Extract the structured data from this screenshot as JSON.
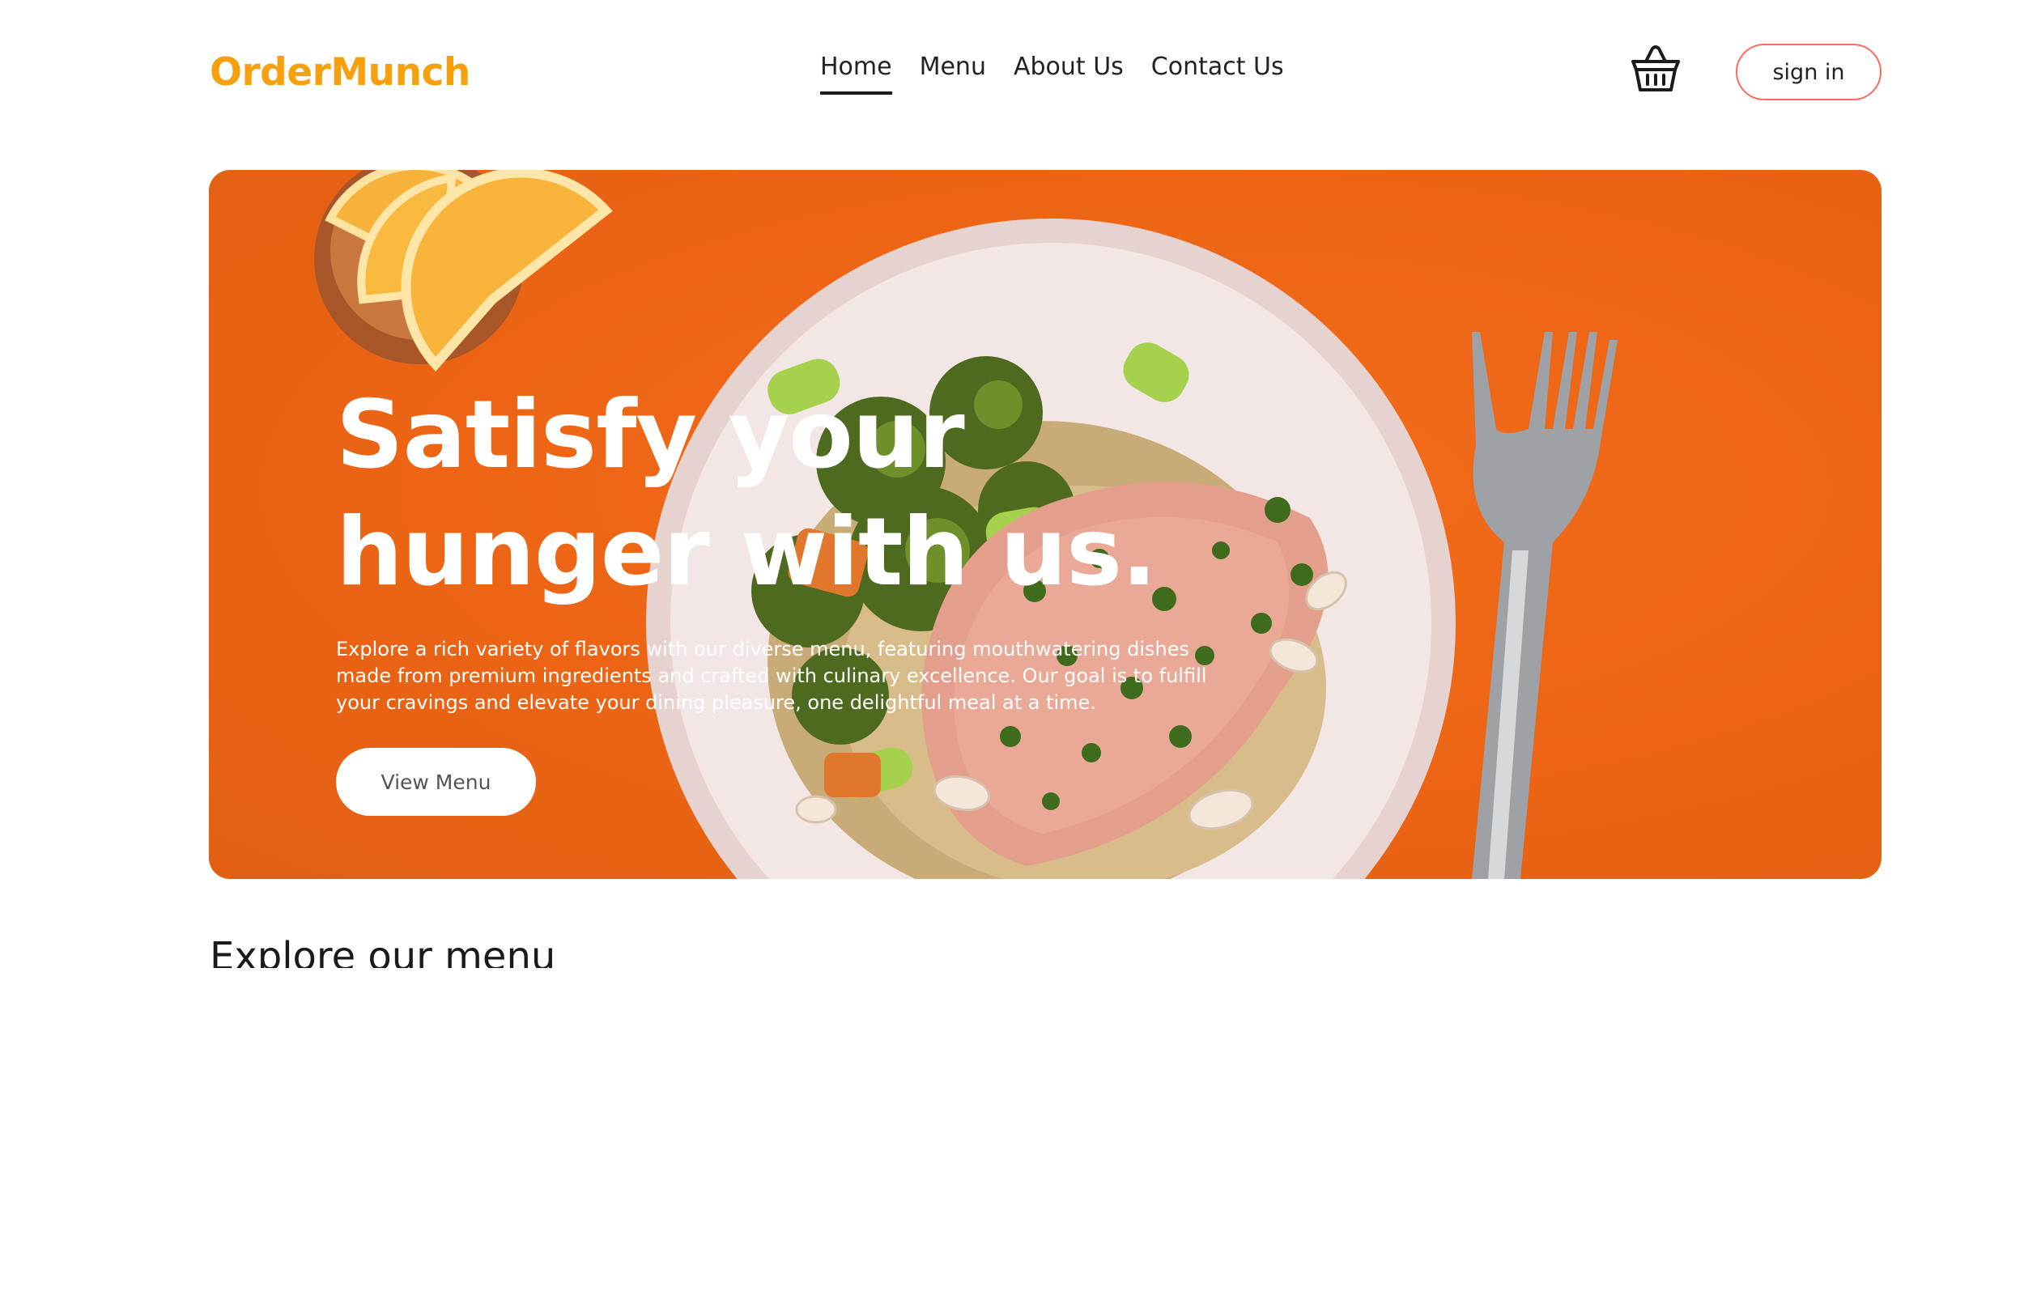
{
  "brand": {
    "name": "OrderMunch",
    "color": "#f5a00c"
  },
  "nav": {
    "items": [
      {
        "label": "Home",
        "active": true
      },
      {
        "label": "Menu",
        "active": false
      },
      {
        "label": "About Us",
        "active": false
      },
      {
        "label": "Contact Us",
        "active": false
      }
    ]
  },
  "header": {
    "cart_icon": "basket-icon",
    "signin_label": "sign in"
  },
  "hero": {
    "title": "Satisfy your hunger with us.",
    "description": "Explore a rich variety of flavors with our diverse menu, featuring mouthwatering dishes made from premium ingredients and crafted with culinary excellence. Our goal is to fulfill your cravings and elevate your dining pleasure, one delightful meal at a time.",
    "button_label": "View Menu",
    "background_color": "#ec6414"
  },
  "section": {
    "title": "Explore our menu"
  }
}
